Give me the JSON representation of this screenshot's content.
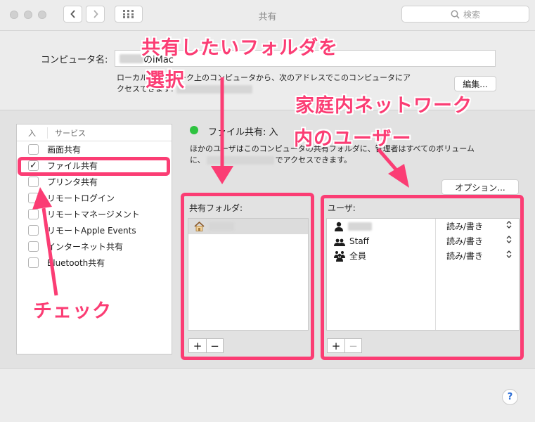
{
  "window": {
    "title": "共有"
  },
  "search": {
    "placeholder": "検索"
  },
  "computer_name": {
    "label": "コンピュータ名:",
    "value_suffix": "のiMac",
    "desc_line1": "ローカルネットワーク上のコンピュータから、次のアドレスでこのコンピュータにア",
    "desc_line2": "クセスできます:",
    "edit_label": "編集..."
  },
  "services": {
    "col_on": "入",
    "col_service": "サービス",
    "items": [
      {
        "label": "画面共有",
        "checked": false
      },
      {
        "label": "ファイル共有",
        "checked": true
      },
      {
        "label": "プリンタ共有",
        "checked": false
      },
      {
        "label": "リモートログイン",
        "checked": false
      },
      {
        "label": "リモートマネージメント",
        "checked": false
      },
      {
        "label": "リモートApple Events",
        "checked": false
      },
      {
        "label": "インターネット共有",
        "checked": false
      },
      {
        "label": "Bluetooth共有",
        "checked": false
      }
    ]
  },
  "status": {
    "title": "ファイル共有: 入",
    "desc_line1": "ほかのユーザはこのコンピュータの共有フォルダに、管理者はすべてのボリューム",
    "desc_line2_prefix": "に、",
    "desc_line2_suffix": "でアクセスできます。",
    "color": "#2ec340"
  },
  "options_label": "オプション...",
  "shared_folders": {
    "label": "共有フォルダ:"
  },
  "users": {
    "label": "ユーザ:",
    "rows": [
      {
        "name": "",
        "icon": "person-icon",
        "perm": "読み/書き"
      },
      {
        "name": "Staff",
        "icon": "group-icon",
        "perm": "読み/書き"
      },
      {
        "name": "全員",
        "icon": "everyone-icon",
        "perm": "読み/書き"
      }
    ]
  },
  "buttons": {
    "plus": "+",
    "minus": "−"
  },
  "help_label": "?",
  "annotations": {
    "folder_line1": "共有したいフォルダを",
    "folder_line2": "選択",
    "users_line1": "家庭内ネットワーク",
    "users_line2": "内のユーザー",
    "check": "チェック",
    "color": "#fb3d74"
  }
}
